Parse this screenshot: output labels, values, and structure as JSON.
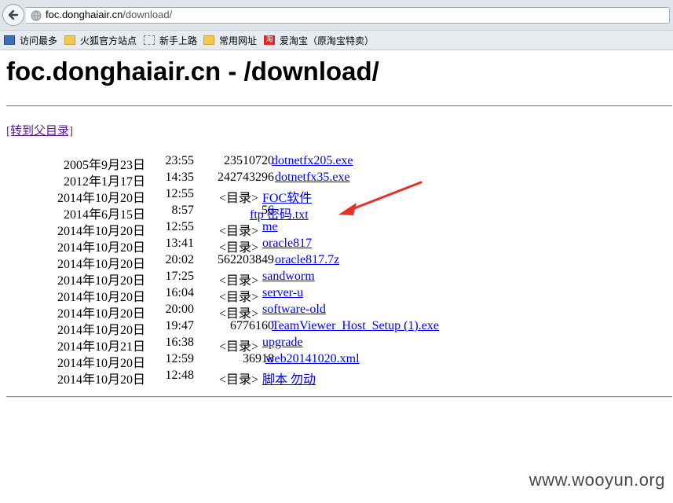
{
  "browser": {
    "url_host": "foc.donghaiair.cn",
    "url_path": "/download/"
  },
  "bookmarks": [
    {
      "label": "访问最多",
      "icon": "most-visited-icon"
    },
    {
      "label": "火狐官方站点",
      "icon": "folder-icon"
    },
    {
      "label": "新手上路",
      "icon": "blank-page-icon"
    },
    {
      "label": "常用网址",
      "icon": "folder-icon"
    },
    {
      "label": "爱淘宝（原淘宝特卖）",
      "icon": "taobao-icon"
    }
  ],
  "page": {
    "title": "foc.donghaiair.cn - /download/",
    "parent_link": "[转到父目录]"
  },
  "listing": [
    {
      "date": "2005年9月23日",
      "time": "23:55",
      "size": "23510720",
      "name": "dotnetfx205.exe",
      "dir": false
    },
    {
      "date": "2012年1月17日",
      "time": "14:35",
      "size": "242743296",
      "name": "dotnetfx35.exe",
      "dir": false
    },
    {
      "date": "2014年10月20日",
      "time": "12:55",
      "size": "<目录>",
      "name": "FOC软件",
      "dir": true
    },
    {
      "date": "2014年6月15日",
      "time": "8:57",
      "size": "56",
      "name": "ftp 密码.txt",
      "dir": false
    },
    {
      "date": "2014年10月20日",
      "time": "12:55",
      "size": "<目录>",
      "name": "me",
      "dir": true
    },
    {
      "date": "2014年10月20日",
      "time": "13:41",
      "size": "<目录>",
      "name": "oracle817",
      "dir": true
    },
    {
      "date": "2014年10月20日",
      "time": "20:02",
      "size": "562203849",
      "name": "oracle817.7z",
      "dir": false
    },
    {
      "date": "2014年10月20日",
      "time": "17:25",
      "size": "<目录>",
      "name": "sandworm",
      "dir": true
    },
    {
      "date": "2014年10月20日",
      "time": "16:04",
      "size": "<目录>",
      "name": "server-u",
      "dir": true
    },
    {
      "date": "2014年10月20日",
      "time": "20:00",
      "size": "<目录>",
      "name": "software-old",
      "dir": true
    },
    {
      "date": "2014年10月20日",
      "time": "19:47",
      "size": "6776160",
      "name": "TeamViewer_Host_Setup (1).exe",
      "dir": false
    },
    {
      "date": "2014年10月21日",
      "time": "16:38",
      "size": "<目录>",
      "name": "upgrade",
      "dir": true
    },
    {
      "date": "2014年10月20日",
      "time": "12:59",
      "size": "36918",
      "name": "web20141020.xml",
      "dir": false
    },
    {
      "date": "2014年10月20日",
      "time": "12:48",
      "size": "<目录>",
      "name": "脚本 勿动",
      "dir": true
    }
  ],
  "watermark": "www.wooyun.org",
  "colors": {
    "link": "#0000ee",
    "visited_link": "#551a8b",
    "annotation_arrow": "#e8302a"
  }
}
